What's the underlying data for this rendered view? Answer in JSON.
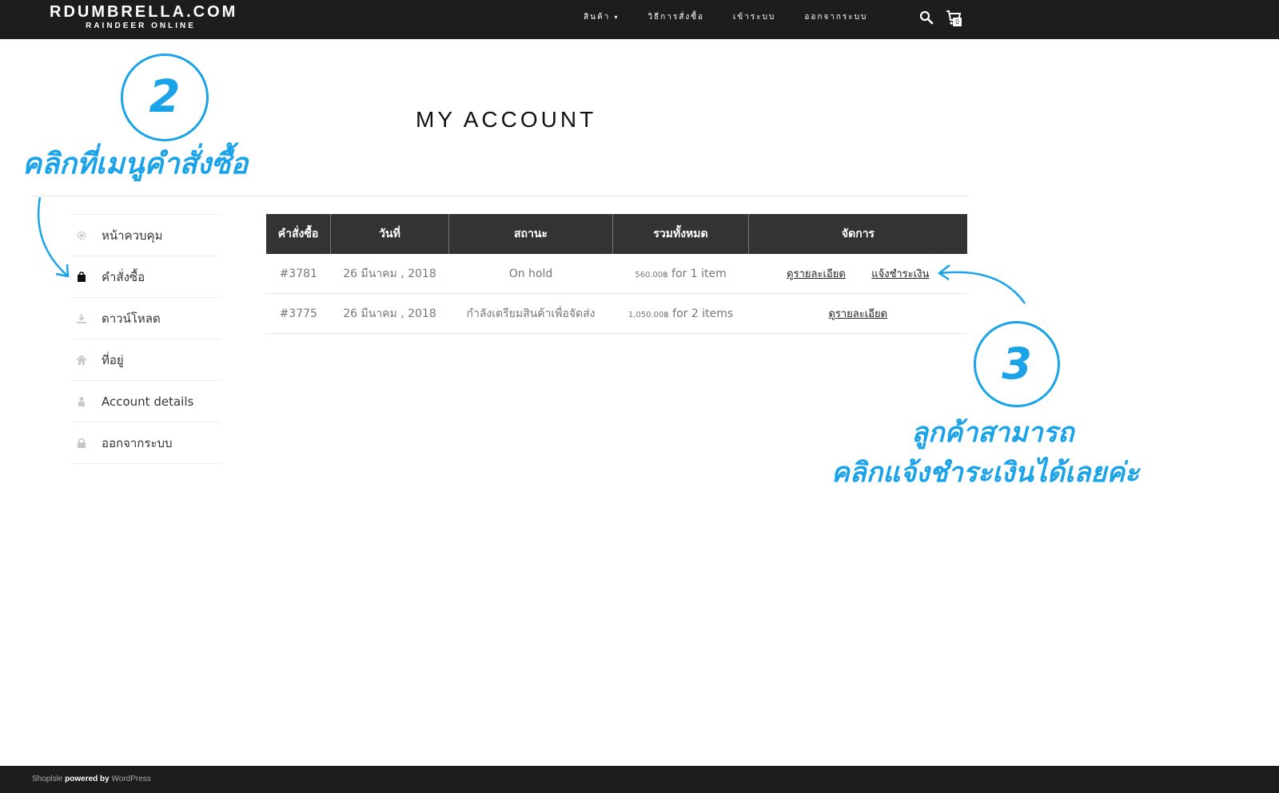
{
  "header": {
    "logo_main": "RDUMBRELLA.COM",
    "logo_sub": "RAINDEER ONLINE",
    "nav": {
      "products": "สินค้า",
      "how_to_order": "วิธีการสั่งซื้อ",
      "login": "เข้าระบบ",
      "logout": "ออกจากระบบ"
    },
    "cart_count": "0"
  },
  "page": {
    "title": "MY ACCOUNT"
  },
  "sidebar": {
    "items": [
      {
        "label": "หน้าควบคุม",
        "icon": "gear-icon"
      },
      {
        "label": "คำสั่งซื้อ",
        "icon": "shopping-bag-icon"
      },
      {
        "label": "ดาวน์โหลด",
        "icon": "download-icon"
      },
      {
        "label": "ที่อยู่",
        "icon": "home-icon"
      },
      {
        "label": "Account details",
        "icon": "user-icon"
      },
      {
        "label": "ออกจากระบบ",
        "icon": "lock-icon"
      }
    ]
  },
  "orders": {
    "headers": [
      "คำสั่งซื้อ",
      "วันที่",
      "สถานะ",
      "รวมทั้งหมด",
      "จัดการ"
    ],
    "rows": [
      {
        "order": "#3781",
        "date": "26 มีนาคม , 2018",
        "status": "On hold",
        "total_amount": "560.00฿",
        "total_items": " for 1 item",
        "view_label": "ดูรายละเอียด",
        "pay_label": "แจ้งชำระเงิน"
      },
      {
        "order": "#3775",
        "date": "26 มีนาคม , 2018",
        "status": "กำลังเตรียมสินค้าเพื่อจัดส่ง",
        "total_amount": "1,050.00฿",
        "total_items": " for 2 items",
        "view_label": "ดูรายละเอียด"
      }
    ]
  },
  "annotations": {
    "step2_number": "2",
    "step2_text": "คลิกที่เมนูคำสั่งซื้อ",
    "step3_number": "3",
    "step3_line1": "ลูกค้าสามารถ",
    "step3_line2": "คลิกแจ้งชำระเงินได้เลยค่ะ",
    "color": "#1aa3e8"
  },
  "footer": {
    "brand": "Shoplsle",
    "powered": "powered by",
    "platform": "WordPress"
  }
}
